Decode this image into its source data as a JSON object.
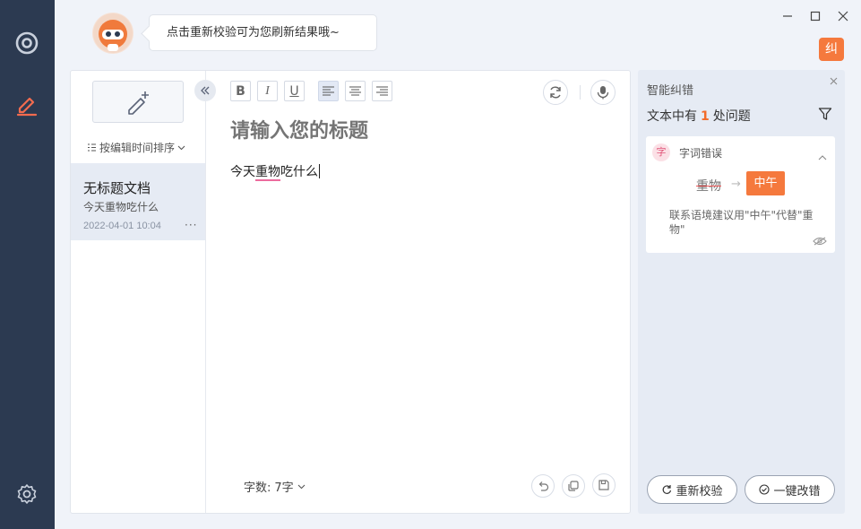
{
  "header": {
    "tip": "点击重新校验可为您刷新结果哦~",
    "badge": "纠"
  },
  "sidebar": {
    "sort_label": "按编辑时间排序",
    "docs": [
      {
        "title": "无标题文档",
        "snippet": "今天重物吃什么",
        "time": "2022-04-01 10:04",
        "more": "···"
      }
    ]
  },
  "editor": {
    "title_placeholder": "请输入您的标题",
    "text_before": "今天",
    "error_word": "重物",
    "text_after": "吃什么",
    "toolbar": {
      "bold": "B",
      "italic": "I",
      "underline": "U"
    },
    "wordcount_label": "字数:",
    "wordcount_value": "7字"
  },
  "panel": {
    "title": "智能纠错",
    "count_prefix": "文本中有",
    "count": "1",
    "count_suffix": "处问题",
    "error": {
      "type_icon": "字",
      "type": "字词错误",
      "original": "重物",
      "arrow": "→",
      "suggestion": "中午",
      "explanation": "联系语境建议用\"中午\"代替\"重物\""
    },
    "recheck_label": "重新校验",
    "fixall_label": "一键改错"
  },
  "colors": {
    "accent": "#f5793d",
    "rail": "#2c3a51",
    "error_underline": "#ec6c9d",
    "rail_active_icon": "#f26b4f"
  },
  "icons": {
    "rail": [
      "target-icon",
      "pen-icon",
      "gear-icon"
    ],
    "toolbar": [
      "align-left-icon",
      "align-center-icon",
      "align-right-icon",
      "refresh-icon",
      "microphone-icon"
    ],
    "footer": [
      "undo-icon",
      "copy-icon",
      "save-icon"
    ]
  }
}
